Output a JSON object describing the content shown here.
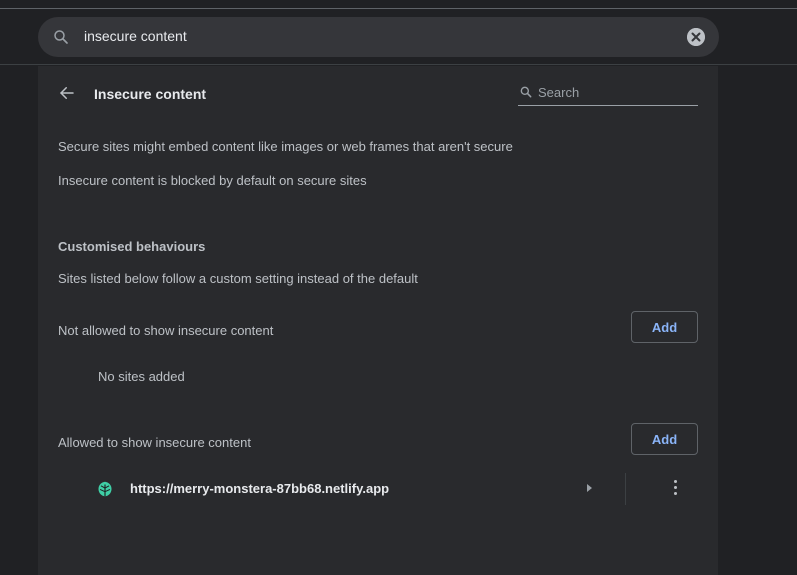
{
  "search": {
    "value": "insecure content"
  },
  "header": {
    "title": "Insecure content",
    "search_placeholder": "Search"
  },
  "description": {
    "line1": "Secure sites might embed content like images or web frames that aren't secure",
    "line2": "Insecure content is blocked by default on secure sites"
  },
  "custom": {
    "title": "Customised behaviours",
    "subtitle": "Sites listed below follow a custom setting instead of the default"
  },
  "not_allowed": {
    "label": "Not allowed to show insecure content",
    "add_label": "Add",
    "empty_text": "No sites added"
  },
  "allowed": {
    "label": "Allowed to show insecure content",
    "add_label": "Add",
    "sites": [
      {
        "url": "https://merry-monstera-87bb68.netlify.app",
        "icon": "netlify-leaf-icon"
      }
    ]
  },
  "colors": {
    "accent": "#8ab4f8",
    "background": "#202124",
    "card": "#292a2d",
    "favicon": "#3fcfa6"
  }
}
